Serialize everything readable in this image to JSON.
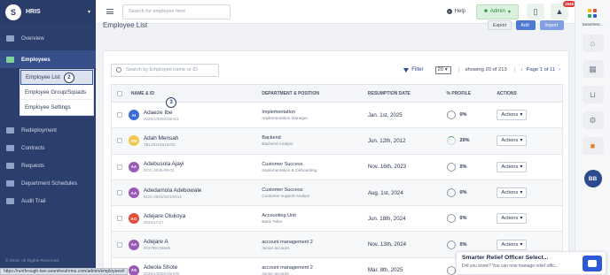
{
  "app": {
    "title": "HRIS",
    "logo_glyph": "S"
  },
  "sidebar": {
    "items": [
      {
        "label": "Overview",
        "icon": "overview-icon"
      },
      {
        "label": "Employees",
        "icon": "employees-icon"
      },
      {
        "label": "Redeployment",
        "icon": "redeployment-icon"
      },
      {
        "label": "Contracts",
        "icon": "contracts-icon"
      },
      {
        "label": "Requests",
        "icon": "requests-icon"
      },
      {
        "label": "Department Schedules",
        "icon": "schedules-icon"
      },
      {
        "label": "Audit Trail",
        "icon": "audit-icon"
      }
    ],
    "submenu": [
      "Employee List",
      "Employee Group/Squads",
      "Employee Settings"
    ],
    "copyright": "© 2025. All Rights Reserved."
  },
  "annotations": {
    "step2": "2",
    "step3": "3"
  },
  "topbar": {
    "search_placeholder": "Search for employee here",
    "help": "Help",
    "admin": "Admin",
    "notification_count": "1646"
  },
  "page": {
    "title": "Employee List",
    "export": "Export",
    "add": "Add",
    "import": "Import"
  },
  "toolbar": {
    "search_placeholder": "Search by Employee name or ID",
    "filter": "Filter",
    "per_page": "20",
    "showing": "showing 20 of 213",
    "pagination": "Page 1 of 11"
  },
  "table": {
    "headers": {
      "name": "NAME & ID",
      "department": "DEPARTMENT & POSITION",
      "resumption": "RESUMPTION DATE",
      "profile": "% PROFILE",
      "actions": "ACTIONS"
    },
    "action_label": "Actions",
    "rows": [
      {
        "initials": "AI",
        "color": "#3d6bd8",
        "name": "Adaeze Ibe",
        "id": "2025/1/3002/15/441",
        "dept": "Implementation",
        "position": "Implementation Manager",
        "date": "Jan. 1st, 2025",
        "profile": "0%"
      },
      {
        "initials": "AM",
        "color": "#f2c94c",
        "name": "Adah Mensah",
        "id": "TBL20201615232",
        "dept": "Backend",
        "position": "Backend Analyst",
        "date": "Jun. 12th, 2012",
        "profile": "20%"
      },
      {
        "initials": "AA",
        "color": "#9b59b6",
        "name": "Adebusola Ajayi",
        "id": "DOC-2025-09-01",
        "dept": "Customer Success",
        "position": "Implementation & Onboarding",
        "date": "Nov. 16th, 2023",
        "profile": "0%"
      },
      {
        "initials": "AA",
        "color": "#9b59b6",
        "name": "Adedamola Adebowale",
        "id": "DOC-2024/10/10/414",
        "dept": "Customer Success",
        "position": "Customer support Analyst",
        "date": "Aug. 1st, 2024",
        "profile": "0%"
      },
      {
        "initials": "AO",
        "color": "#e74c3c",
        "name": "Adejare Olukoya",
        "id": "2024/17/17",
        "dept": "Accounting Unit",
        "position": "Bank Teller",
        "date": "Jun. 18th, 2024",
        "profile": "0%"
      },
      {
        "initials": "AA",
        "color": "#9b59b6",
        "name": "Adejare A",
        "id": "003789126566",
        "dept": "account management 2",
        "position": "Junior account",
        "date": "Nov. 13th, 2024",
        "profile": "0%"
      },
      {
        "initials": "AS",
        "color": "#9b59b6",
        "name": "Adeola Shote",
        "id": "2025/1/3002/15/470",
        "dept": "account management 2",
        "position": "Junior account",
        "date": "Mar. 8th, 2025",
        "profile": "0%"
      }
    ]
  },
  "rightbar": {
    "label": "Seamless...",
    "avatar": "BB"
  },
  "toast": {
    "title": "Smarter Relief Officer Select...",
    "body": "Did you know? You can now manage relief offic..."
  },
  "status_url": "https://runthrough-two.seamlesshrms.com/admin/employees#"
}
